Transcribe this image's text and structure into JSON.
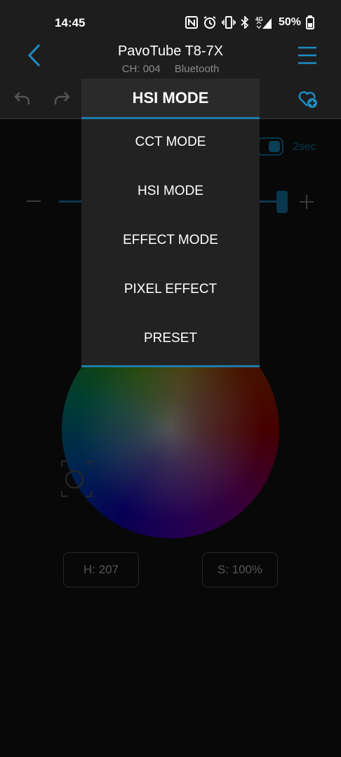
{
  "status_bar": {
    "time": "14:45",
    "battery": "50%",
    "icons": [
      "nfc-icon",
      "alarm-icon",
      "vibrate-icon",
      "bluetooth-icon",
      "4g-signal-icon",
      "battery-icon"
    ],
    "network_label": "4G"
  },
  "header": {
    "device_name": "PavoTube T8-7X",
    "channel": "CH: 004",
    "connection": "Bluetooth",
    "accent_color": "#1e7ba8"
  },
  "controls": {
    "fade_time": "2sec"
  },
  "color_values": {
    "hue": "H: 207",
    "saturation": "S: 100%"
  },
  "mode_dropdown": {
    "selected": "HSI MODE",
    "options": [
      "CCT MODE",
      "HSI MODE",
      "EFFECT MODE",
      "PIXEL EFFECT",
      "PRESET"
    ]
  }
}
